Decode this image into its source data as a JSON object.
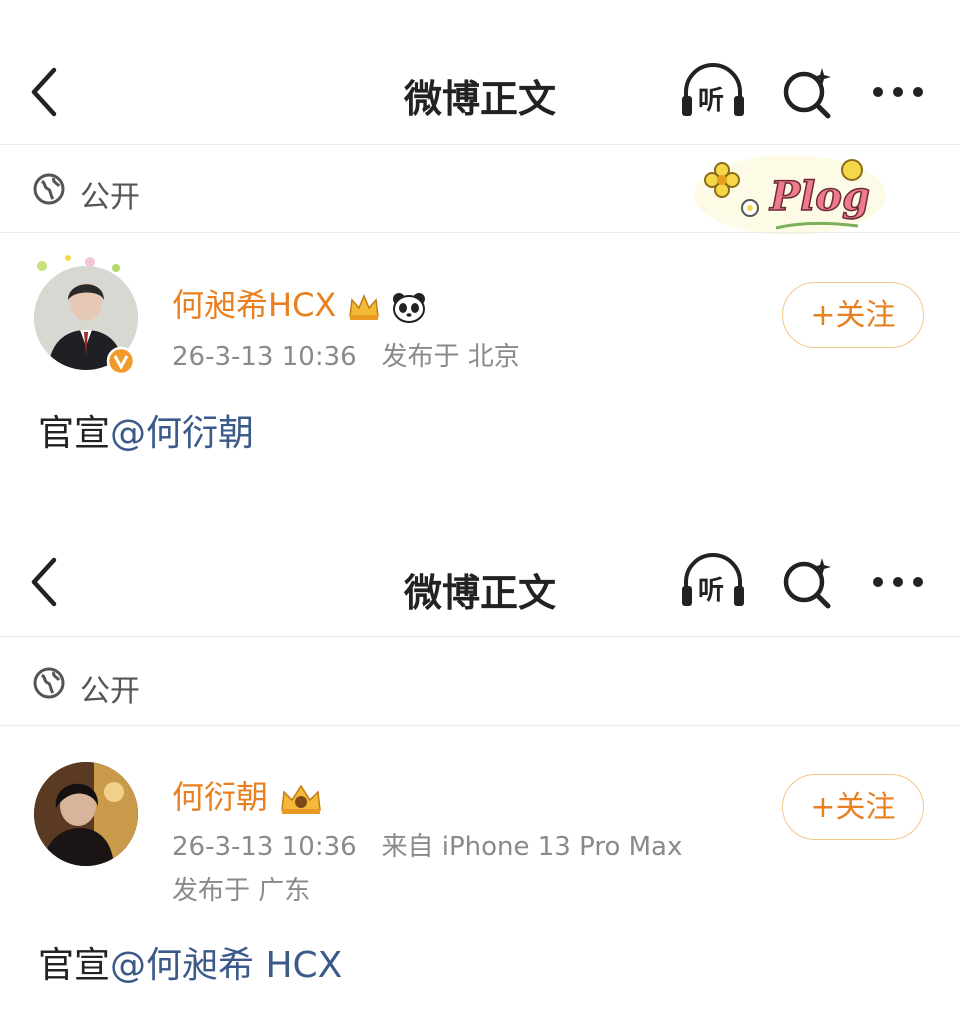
{
  "screens": [
    {
      "nav": {
        "title": "微博正文",
        "listen_label": "听"
      },
      "visibility": "公开",
      "author": {
        "name": "何昶希HCX"
      },
      "timestamp": "26-3-13 10:36",
      "location": "发布于 北京",
      "follow_label": "+关注",
      "content": {
        "prefix": "官宣",
        "mention": "@何衍朝"
      }
    },
    {
      "nav": {
        "title": "微博正文",
        "listen_label": "听"
      },
      "visibility": "公开",
      "author": {
        "name": "何衍朝"
      },
      "timestamp": "26-3-13 10:36",
      "source": "来自 iPhone 13 Pro Max",
      "location": "发布于 广东",
      "follow_label": "+关注",
      "content": {
        "prefix": "官宣",
        "mention": "@何昶希 HCX"
      }
    }
  ],
  "sticker_text": "Plog",
  "colors": {
    "accent": "#e8801f",
    "mention": "#3b5a8a",
    "follow_border": "#f1c78a"
  }
}
